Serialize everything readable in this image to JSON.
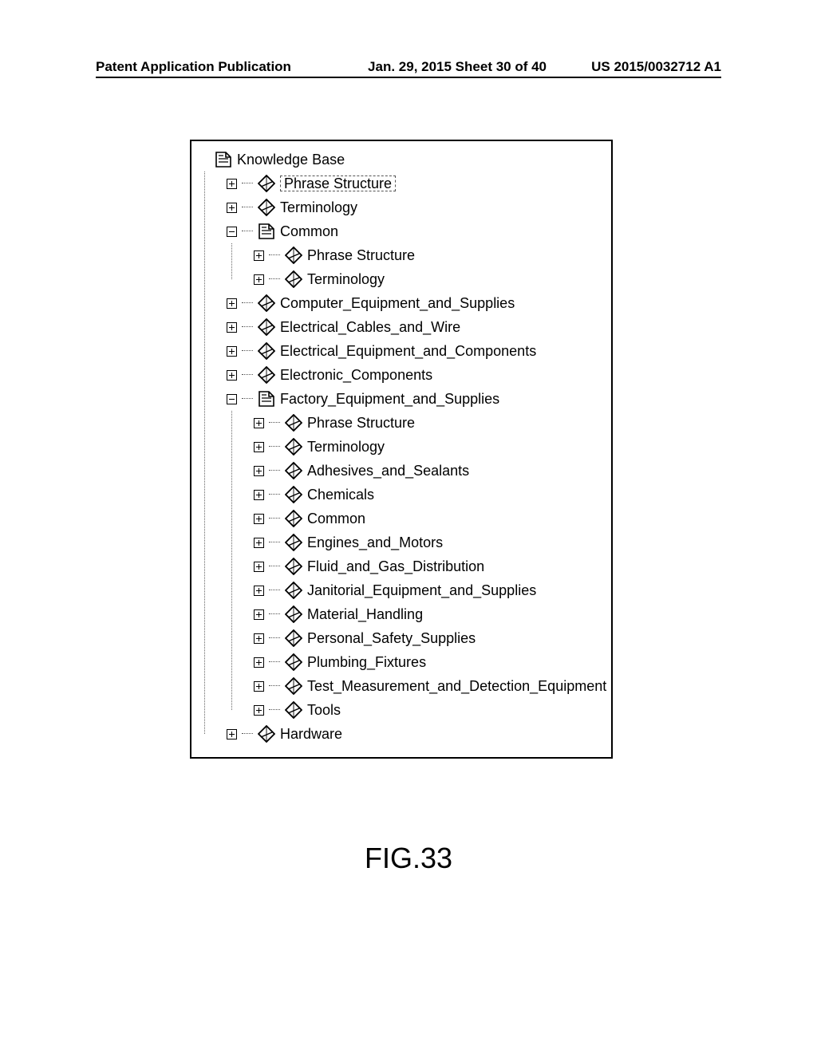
{
  "header": {
    "left": "Patent Application Publication",
    "center": "Jan. 29, 2015  Sheet 30 of 40",
    "right": "US 2015/0032712 A1"
  },
  "figure_label": "FIG.33",
  "tree": {
    "root": "Knowledge Base",
    "items": [
      {
        "label": "Phrase Structure",
        "type": "diamond",
        "exp": "plus",
        "selected": true
      },
      {
        "label": "Terminology",
        "type": "diamond",
        "exp": "plus"
      },
      {
        "label": "Common",
        "type": "book",
        "exp": "minus",
        "children": [
          {
            "label": "Phrase Structure",
            "type": "diamond",
            "exp": "plus"
          },
          {
            "label": "Terminology",
            "type": "diamond",
            "exp": "plus"
          }
        ]
      },
      {
        "label": "Computer_Equipment_and_Supplies",
        "type": "diamond",
        "exp": "plus"
      },
      {
        "label": "Electrical_Cables_and_Wire",
        "type": "diamond",
        "exp": "plus"
      },
      {
        "label": "Electrical_Equipment_and_Components",
        "type": "diamond",
        "exp": "plus"
      },
      {
        "label": "Electronic_Components",
        "type": "diamond",
        "exp": "plus"
      },
      {
        "label": "Factory_Equipment_and_Supplies",
        "type": "book",
        "exp": "minus",
        "children": [
          {
            "label": "Phrase Structure",
            "type": "diamond",
            "exp": "plus"
          },
          {
            "label": "Terminology",
            "type": "diamond",
            "exp": "plus"
          },
          {
            "label": "Adhesives_and_Sealants",
            "type": "diamond",
            "exp": "plus"
          },
          {
            "label": "Chemicals",
            "type": "diamond",
            "exp": "plus"
          },
          {
            "label": "Common",
            "type": "diamond",
            "exp": "plus"
          },
          {
            "label": "Engines_and_Motors",
            "type": "diamond",
            "exp": "plus"
          },
          {
            "label": "Fluid_and_Gas_Distribution",
            "type": "diamond",
            "exp": "plus"
          },
          {
            "label": "Janitorial_Equipment_and_Supplies",
            "type": "diamond",
            "exp": "plus"
          },
          {
            "label": "Material_Handling",
            "type": "diamond",
            "exp": "plus"
          },
          {
            "label": "Personal_Safety_Supplies",
            "type": "diamond",
            "exp": "plus"
          },
          {
            "label": "Plumbing_Fixtures",
            "type": "diamond",
            "exp": "plus"
          },
          {
            "label": "Test_Measurement_and_Detection_Equipment",
            "type": "diamond",
            "exp": "plus"
          },
          {
            "label": "Tools",
            "type": "diamond",
            "exp": "plus"
          }
        ]
      },
      {
        "label": "Hardware",
        "type": "diamond",
        "exp": "plus"
      }
    ]
  }
}
